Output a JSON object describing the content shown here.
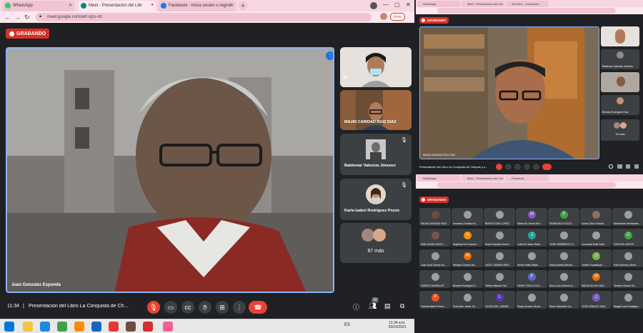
{
  "main_window": {
    "tabs": [
      {
        "label": "WhatsApp",
        "color": "#25d366"
      },
      {
        "label": "Meet - Presentacion del Libr",
        "color": "#00897b"
      },
      {
        "label": "Facebook - Inicia sesión o regístr",
        "color": "#1877f2"
      }
    ],
    "new_tab_symbol": "+",
    "url": "meet.google.com/ekf-xjzu-rtc",
    "profile_button": "Error",
    "recording_label": "GRABANDO",
    "speaker_name": "Juan Gonzalez Esponda",
    "participants": [
      {
        "name": "MAJIN CARIDAD RUIZ DIAZ"
      },
      {
        "name": "Baldemar Valencia Jimenez"
      },
      {
        "name": "Karla Isabel Rodríguez Pozos"
      }
    ],
    "more_count": "87 más",
    "time": "11:34",
    "meeting_title": "Presentacion del Libro La Conquista de Ch...",
    "people_count": "92",
    "tile_abbr": "Tr"
  },
  "taskbar": {
    "lang": "ES",
    "clock_time": "11:34 a.m.",
    "clock_date": "29/10/2021"
  },
  "right_top_window": {
    "recording_label": "GRABANDO",
    "speaker_name": "MAJIN CARIDAD RUIZ DIAZ",
    "caption": "Presentacion del Libro La Conquista de Chiapas y s...",
    "side_names": [
      "Baldemar Valencia Jimenez",
      "Brenda Rodríguez Díaz"
    ],
    "more_count": "33 más"
  },
  "right_bottom_window": {
    "recording_label": "GRABANDO",
    "grid": [
      {
        "name": "MAJIN CARIDAD RUIZ",
        "initial": "",
        "color": "#6d4c41"
      },
      {
        "name": "Amanda Ornelas Ho...",
        "initial": "",
        "color": "#9e9e9e"
      },
      {
        "name": "BENITO DÍAZ LÓPEZ",
        "initial": "",
        "color": "#9e9e9e"
      },
      {
        "name": "María De Jesús Ros...",
        "initial": "M",
        "color": "#7e57c2"
      },
      {
        "name": "FRANCISCA SOCO...",
        "initial": "F",
        "color": "#43a047"
      },
      {
        "name": "Laura Chico Gonzál...",
        "initial": "",
        "color": "#8d6e63"
      },
      {
        "name": "Mariaemel Hernández...",
        "initial": "",
        "color": "#9e9e9e"
      },
      {
        "name": "ANA LAURA SOLIS ...",
        "initial": "",
        "color": "#795548"
      },
      {
        "name": "Angelica Del Carmen...",
        "initial": "A",
        "color": "#fb8c00"
      },
      {
        "name": "Israel Carolina Gome...",
        "initial": "",
        "color": "#9e9e9e"
      },
      {
        "name": "José De Jesús Rami...",
        "initial": "J",
        "color": "#26a69a"
      },
      {
        "name": "JOSE HERIBERTO D...",
        "initial": "",
        "color": "#9e9e9e"
      },
      {
        "name": "Leonardo Ávila Ram...",
        "initial": "",
        "color": "#9e9e9e"
      },
      {
        "name": "CINTHYA JUDITH ...",
        "initial": "C",
        "color": "#43a047"
      },
      {
        "name": "Juan José García Va...",
        "initial": "",
        "color": "#9e9e9e"
      },
      {
        "name": "Micaela Gómez Ma...",
        "initial": "M",
        "color": "#ef6c00"
      },
      {
        "name": "LESLY YASMIN HER...",
        "initial": "",
        "color": "#9e9e9e"
      },
      {
        "name": "Irmeth Itzela Mejia...",
        "initial": "",
        "color": "#9e9e9e"
      },
      {
        "name": "Delya Marely Mendo...",
        "initial": "",
        "color": "#9e9e9e"
      },
      {
        "name": "Joselin Guadalupe ...",
        "initial": "J",
        "color": "#7cb342"
      },
      {
        "name": "Sofía Monroy Jimen...",
        "initial": "",
        "color": "#9e9e9e"
      },
      {
        "name": "KAREN GUADALUP...",
        "initial": "",
        "color": "#9e9e9e"
      },
      {
        "name": "Brenda Rodriguez D...",
        "initial": "",
        "color": "#9e9e9e"
      },
      {
        "name": "Yaritza Manuel Cal...",
        "initial": "",
        "color": "#9e9e9e"
      },
      {
        "name": "FANNY PAOLA SOL...",
        "initial": "F",
        "color": "#5c6bc0"
      },
      {
        "name": "Ana Lucía Jiménez A...",
        "initial": "",
        "color": "#9e9e9e"
      },
      {
        "name": "MARIA SILVIA DÍAZ...",
        "initial": "M",
        "color": "#ef6c00"
      },
      {
        "name": "Tamara Gomez Mi...",
        "initial": "",
        "color": "#9e9e9e"
      },
      {
        "name": "Fabiola Mariel Perez...",
        "initial": "F",
        "color": "#f4511e"
      },
      {
        "name": "Francisco Javier Gu...",
        "initial": "",
        "color": "#9e9e9e"
      },
      {
        "name": "LAURA DEL CARME...",
        "initial": "L",
        "color": "#5e35b1"
      },
      {
        "name": "Diego Alvarez Guzm...",
        "initial": "",
        "color": "#9e9e9e"
      },
      {
        "name": "Mario Manuelas Ca...",
        "initial": "",
        "color": "#9e9e9e"
      },
      {
        "name": "JOSE IGNACIO SAN...",
        "initial": "J",
        "color": "#7e57c2"
      },
      {
        "name": "Magali Luna Rodrigue...",
        "initial": "",
        "color": "#9e9e9e"
      }
    ]
  }
}
